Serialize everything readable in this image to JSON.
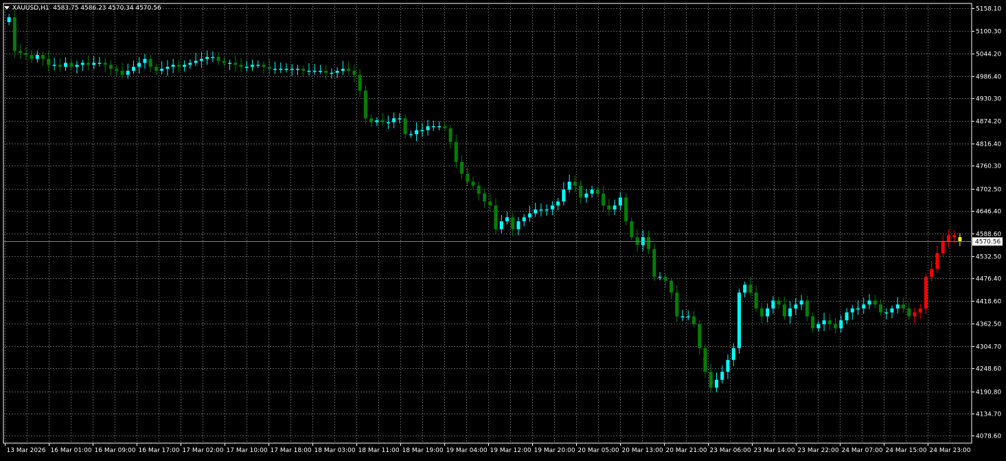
{
  "header": {
    "symbol": "XAUUSD,H1",
    "ohlc": "4583.75 4586.23 4570.34 4570.56"
  },
  "colors": {
    "background": "#000000",
    "grid": "#5a5a5a",
    "axis": "#ffffff",
    "text": "#ffffff",
    "bull_body": "#00ffff",
    "bear_body": "#008000",
    "bull_recent": "#ff0000",
    "bear_recent": "#ff0000",
    "current_bar": "#ffff00",
    "price_line": "#808080"
  },
  "chart_data": {
    "type": "candlestick",
    "symbol": "XAUUSD",
    "timeframe": "H1",
    "y_ticks": [
      "5158.10",
      "5100.30",
      "5044.20",
      "4986.40",
      "4930.30",
      "4874.20",
      "4816.40",
      "4760.30",
      "4702.50",
      "4646.40",
      "4588.60",
      "4532.50",
      "4476.40",
      "4418.60",
      "4362.50",
      "4304.70",
      "4248.60",
      "4190.80",
      "4134.70",
      "4078.60"
    ],
    "ylim": [
      4060,
      5170
    ],
    "x_ticks": [
      "13 Mar 2026",
      "16 Mar 01:00",
      "16 Mar 09:00",
      "16 Mar 17:00",
      "17 Mar 02:00",
      "17 Mar 10:00",
      "17 Mar 18:00",
      "18 Mar 03:00",
      "18 Mar 11:00",
      "18 Mar 19:00",
      "19 Mar 04:00",
      "19 Mar 12:00",
      "19 Mar 20:00",
      "20 Mar 05:00",
      "20 Mar 13:00",
      "20 Mar 21:00",
      "23 Mar 06:00",
      "23 Mar 14:00",
      "23 Mar 22:00",
      "24 Mar 07:00",
      "24 Mar 15:00",
      "24 Mar 23:00"
    ],
    "current_price": "4570.56",
    "current_price_value": 4570.56,
    "close_path": [
      5135,
      5050,
      5045,
      5040,
      5030,
      5040,
      5030,
      5015,
      5015,
      5010,
      5020,
      5010,
      5015,
      5020,
      5015,
      5020,
      5020,
      5015,
      5005,
      5000,
      4990,
      5000,
      5010,
      5020,
      5030,
      5010,
      5000,
      5005,
      5010,
      5015,
      5010,
      5015,
      5020,
      5025,
      5030,
      5035,
      5035,
      5025,
      5020,
      5020,
      5015,
      5010,
      5010,
      5015,
      5015,
      5010,
      5005,
      5005,
      5005,
      5005,
      5005,
      5005,
      5000,
      5000,
      5000,
      5000,
      4995,
      4995,
      5000,
      5005,
      5000,
      4990,
      4950,
      4880,
      4870,
      4875,
      4870,
      4870,
      4880,
      4880,
      4840,
      4840,
      4850,
      4850,
      4860,
      4860,
      4860,
      4855,
      4820,
      4770,
      4740,
      4720,
      4710,
      4690,
      4670,
      4660,
      4600,
      4620,
      4630,
      4600,
      4620,
      4630,
      4640,
      4650,
      4650,
      4650,
      4660,
      4670,
      4700,
      4720,
      4710,
      4680,
      4690,
      4700,
      4690,
      4660,
      4650,
      4660,
      4680,
      4620,
      4580,
      4560,
      4580,
      4550,
      4480,
      4480,
      4470,
      4440,
      4380,
      4380,
      4380,
      4360,
      4300,
      4240,
      4200,
      4220,
      4240,
      4270,
      4300,
      4440,
      4460,
      4440,
      4400,
      4380,
      4400,
      4420,
      4410,
      4380,
      4400,
      4410,
      4420,
      4380,
      4350,
      4360,
      4370,
      4360,
      4350,
      4370,
      4390,
      4400,
      4400,
      4410,
      4420,
      4410,
      4390,
      4390,
      4400,
      4410,
      4400,
      4380,
      4390,
      4400,
      4480,
      4500,
      4540,
      4570,
      4585,
      4580,
      4570
    ],
    "recent_count": 9
  }
}
